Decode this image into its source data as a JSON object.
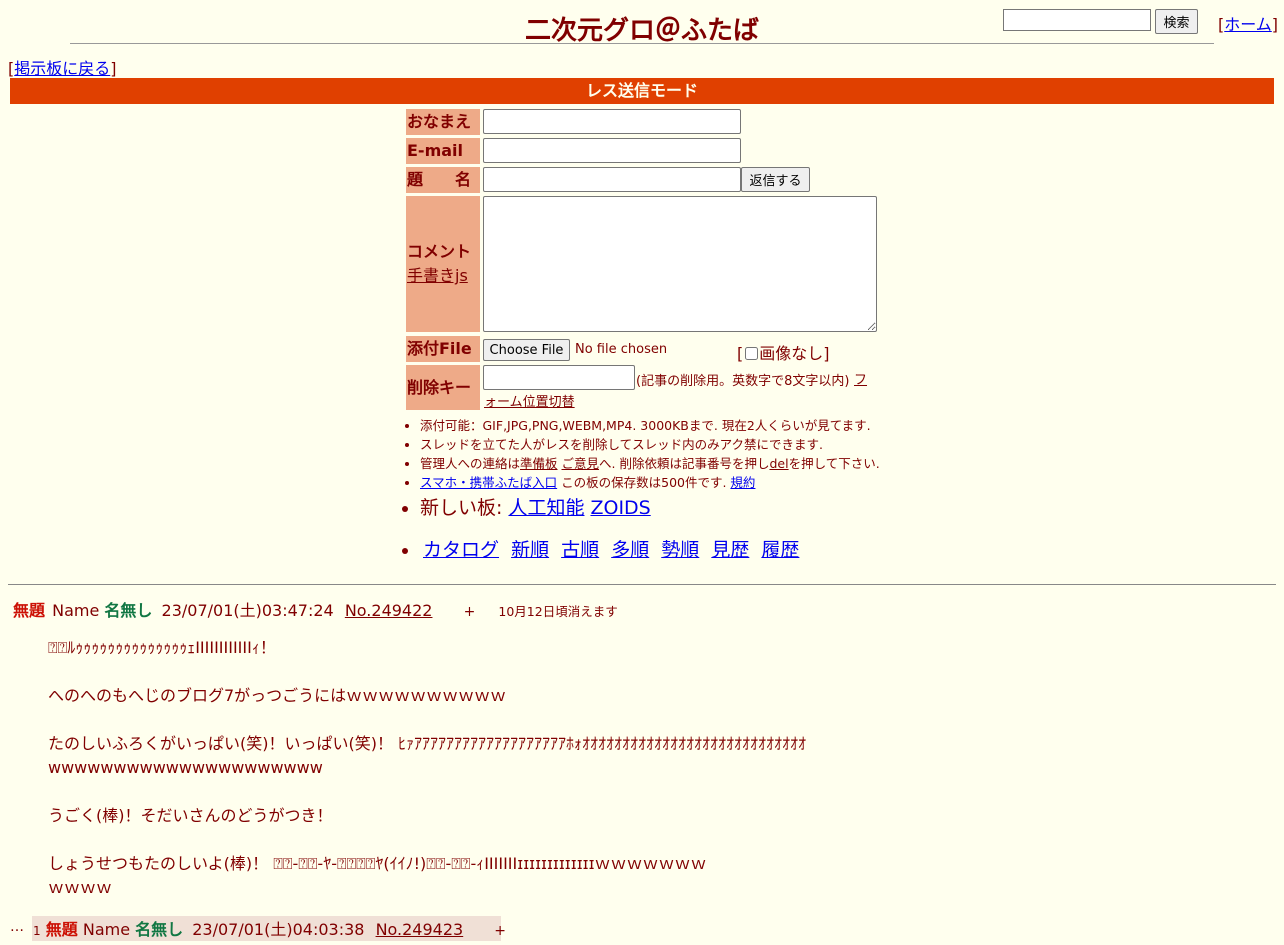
{
  "header": {
    "title": "二次元グロ＠ふたば",
    "search_button": "検索",
    "home_open": "[",
    "home_link": "ホーム",
    "home_close": "]",
    "back_open": "[",
    "back_link": "掲示板に戻る",
    "back_close": "]"
  },
  "mode_bar": "レス送信モード",
  "form": {
    "name_label": "おなまえ",
    "email_label": "E-mail",
    "subject_label": "題　　名",
    "submit_button": "返信する",
    "comment_label": "コメント",
    "tegaki_link": "手書きjs",
    "file_label": "添付File",
    "choose_file_button": "Choose File",
    "no_file_text": "No file chosen",
    "no_image_open": "[",
    "no_image_label": "画像なし",
    "no_image_close": "]",
    "delkey_label": "削除キー",
    "delkey_note": "(記事の削除用。英数字で8文字以内)",
    "form_position_link": "フォーム位置切替"
  },
  "notes": {
    "line1": "添付可能：GIF,JPG,PNG,WEBM,MP4. 3000KBまで. 現在2人くらいが見てます.",
    "line2": "スレッドを立てた人がレスを削除してスレッド内のみアク禁にできます.",
    "line3_pre": "管理人への連絡は",
    "line3_link1": "準備板",
    "line3_link2": "ご意見",
    "line3_mid": "へ. 削除依頼は記事番号を押し",
    "line3_link3": "del",
    "line3_post": "を押して下さい.",
    "line4_link": "スマホ・携帯ふたば入口",
    "line4_mid": " この板の保存数は500件です. ",
    "line4_link2": "規約"
  },
  "new_boards": {
    "label": "新しい板: ",
    "board1": "人工知能",
    "board2": "ZOIDS"
  },
  "nav_links": [
    "カタログ",
    "新順",
    "古順",
    "多順",
    "勢順",
    "見歴",
    "履歴"
  ],
  "post": {
    "subject": "無題",
    "name_prefix": "Name",
    "name": "名無し",
    "datetime": "23/07/01(土)03:47:24",
    "number": "No.249422",
    "plus": "+",
    "expire": "10月12日頃消えます",
    "lines": [
      "⍰⍰ﾙｩｩｩｩｩｩｩｩｩｩｩｩｩｩｪIIIIIIIIIIIIｨ！",
      "",
      "へのへのもへじのブログ7がっつごうにはｗｗｗｗｗｗｗｗｗｗ",
      "",
      "たのしいふろくがいっぱい(笑)！いっぱい(笑)！ ﾋｧｱｱｱｱｱｱｱｱｱｱｱｱｱｱｱｱｱｱｱﾎｫｵｵｵｵｵｵｵｵｵｵｵｵｵｵｵｵｵｵｵｵｵｵｵｵｵｵｵｵ",
      "wwwwwwwwwwwwwwwwwwwww",
      "",
      "うごく(棒)！そだいさんのどうがつき！",
      "",
      "しょうせつもたのしいよ(棒)！ ⍰⍰-⍰⍰-ﾔ-⍰⍰⍰⍰ﾔ(ｲｲﾉ!)⍰⍰-⍰⍰-ｨIIIIIIIɪɪɪɪɪɪɪɪɪɪɪɪɪｗｗｗｗｗｗｗ",
      "ｗｗｗｗ"
    ]
  },
  "reply": {
    "ellipsis": "…",
    "index": "1",
    "subject": "無題",
    "name_prefix": "Name",
    "name": "名無し",
    "datetime": "23/07/01(土)04:03:38",
    "number": "No.249423",
    "plus": "+"
  }
}
